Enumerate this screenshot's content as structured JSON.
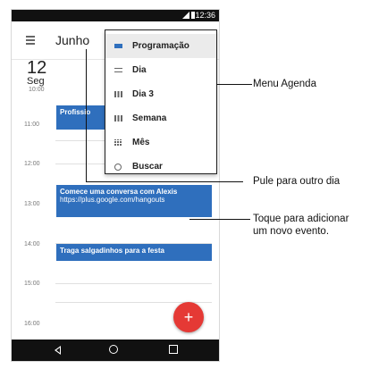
{
  "status_bar": {
    "time": "12:36"
  },
  "app_bar": {
    "month": "Junho"
  },
  "day_header": {
    "day_number": "12",
    "day_name": "Seg",
    "first_hour": "10:00"
  },
  "hours": [
    "11:00",
    "12:00",
    "13:00",
    "14:00",
    "15:00",
    "16:00"
  ],
  "events": [
    {
      "title": "Profissio",
      "subtitle": ""
    },
    {
      "title": "Comece uma conversa com Alexis",
      "subtitle": "https://plus.google.com/hangouts"
    },
    {
      "title": "Traga salgadinhos para a festa",
      "subtitle": ""
    }
  ],
  "menu": {
    "items": [
      {
        "label": "Programação",
        "icon": "schedule-icon"
      },
      {
        "label": "Dia",
        "icon": "day-view-icon"
      },
      {
        "label": "Dia 3",
        "icon": "three-day-icon"
      },
      {
        "label": "Semana",
        "icon": "week-icon"
      },
      {
        "label": "Mês",
        "icon": "month-icon"
      },
      {
        "label": "Buscar",
        "icon": "search-icon"
      }
    ]
  },
  "fab": {
    "symbol": "+"
  },
  "annotations": {
    "menu": "Menu Agenda",
    "jump": "Pule para outro dia",
    "add_line1": "Toque para adicionar",
    "add_line2": "um novo evento."
  },
  "colors": {
    "event_blue": "#2f6fbd",
    "fab_red": "#e53935",
    "bars": "#111111"
  }
}
